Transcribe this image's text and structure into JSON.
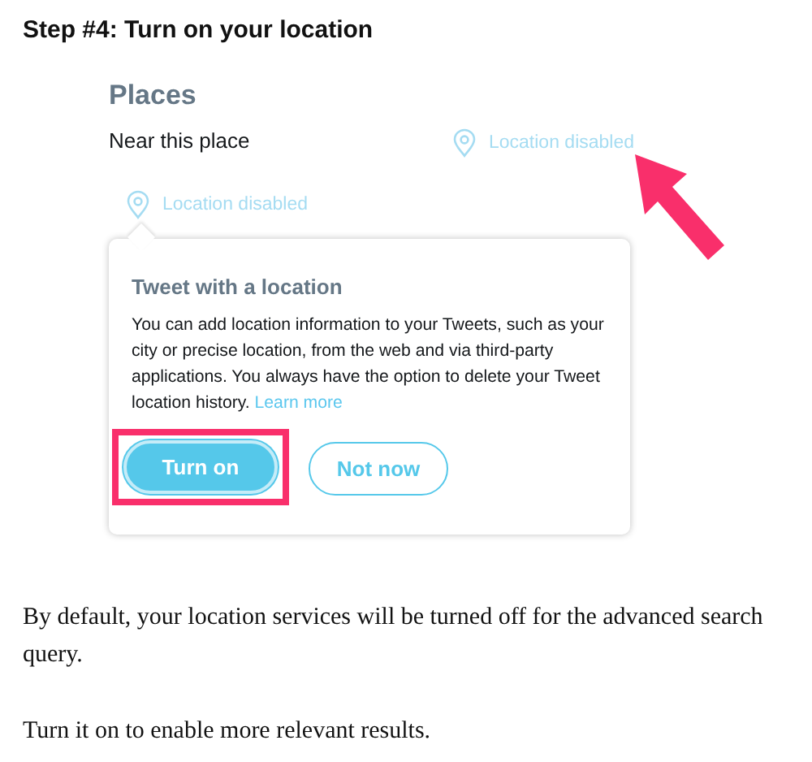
{
  "heading": "Step #4: Turn on your location",
  "places": {
    "title": "Places",
    "near_label": "Near this place",
    "location_status": "Location disabled"
  },
  "composer_location": "Location disabled",
  "popover": {
    "title": "Tweet with a location",
    "body": "You can add location information to your Tweets, such as your city or precise location, from the web and via third-party applications. You always have the option to delete your Tweet location history.",
    "link": "Learn more",
    "buttons": [
      {
        "label": "Turn on",
        "kind": "primary",
        "highlighted": true
      },
      {
        "label": "Not now",
        "kind": "secondary",
        "highlighted": false
      }
    ]
  },
  "paragraphs": [
    "By default, your location services will be turned off for the advanced search query.",
    "Turn it on to enable more relevant results."
  ]
}
